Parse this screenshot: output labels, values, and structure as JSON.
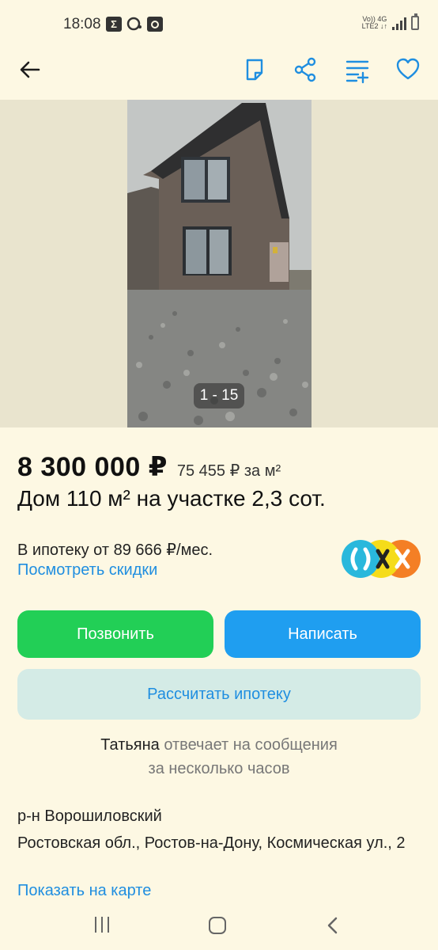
{
  "status_bar": {
    "time": "18:08",
    "notif_icons": [
      "sigma-icon",
      "chat-icon",
      "clock-icon"
    ],
    "net_label_top": "Vo)) 4G",
    "net_label_bottom": "LTE2 ↓↑"
  },
  "toolbar": {
    "icons": [
      "back-arrow-icon",
      "note-icon",
      "share-icon",
      "compare-icon",
      "favorite-heart-icon"
    ],
    "accent_color": "#1f8ee0"
  },
  "gallery": {
    "counter": "1 - 15"
  },
  "listing": {
    "price": "8 300 000 ₽",
    "price_per_m2": "75 455 ₽ за м²",
    "title": "Дом 110 м² на участке 2,3 сот."
  },
  "mortgage": {
    "text": "В ипотеку от 89 666 ₽/мес.",
    "discount_link": "Посмотреть скидки"
  },
  "actions": {
    "call_label": "Позвонить",
    "write_label": "Написать",
    "calc_mortgage_label": "Рассчитать ипотеку",
    "call_color": "#22cf56",
    "write_color": "#1f9ef0"
  },
  "seller": {
    "name": "Татьяна",
    "response_text": " отвечает на сообщения",
    "response_time": "за несколько часов"
  },
  "location": {
    "district": "р-н Ворошиловский",
    "address": "Ростовская обл., Ростов-на-Дону, Космическая ул., 2",
    "map_link": "Показать на карте"
  },
  "nav": {
    "icons": [
      "recent-apps-icon",
      "home-icon",
      "back-icon"
    ]
  }
}
